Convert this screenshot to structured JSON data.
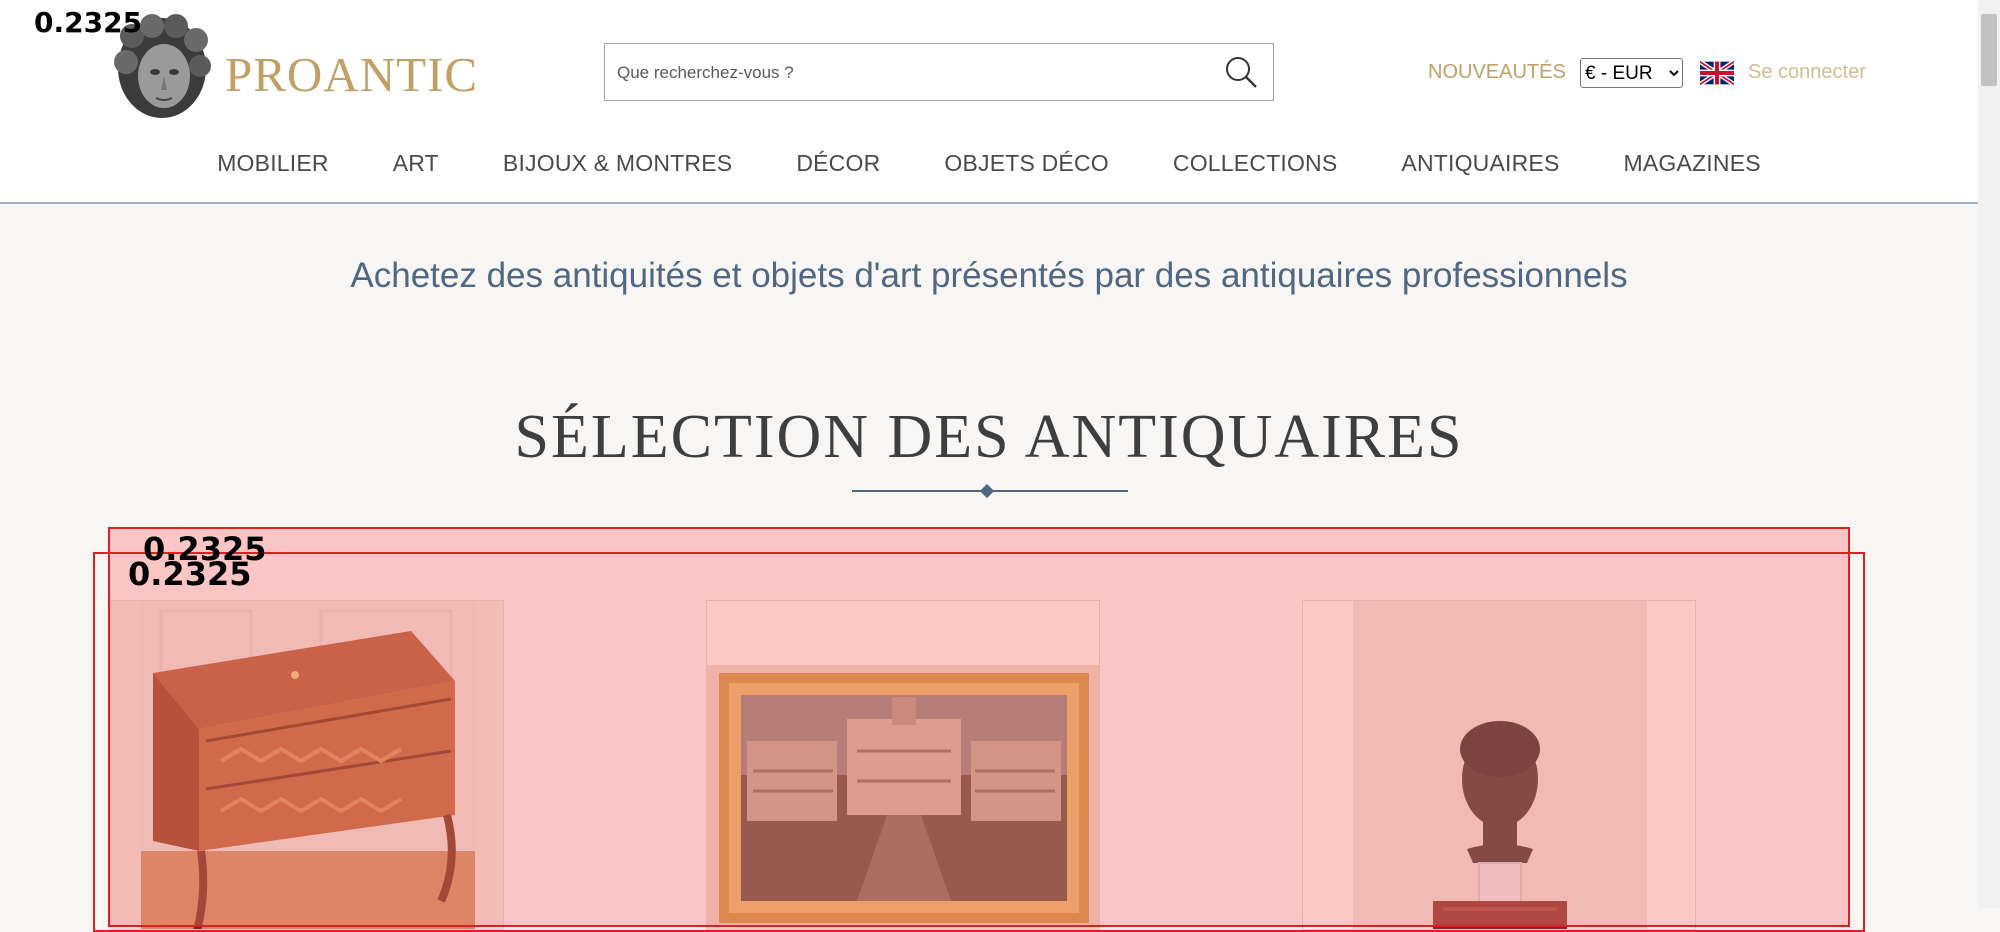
{
  "header": {
    "logo_text": "PROANTIC",
    "search_placeholder": "Que recherchez-vous ?",
    "nouveautes": "NOUVEAUTÉS",
    "currency_selected": "€ - EUR",
    "connect": "Se connecter"
  },
  "nav": {
    "items": [
      "MOBILIER",
      "ART",
      "BIJOUX & MONTRES",
      "DÉCOR",
      "OBJETS DÉCO",
      "COLLECTIONS",
      "ANTIQUAIRES",
      "MAGAZINES"
    ]
  },
  "main": {
    "tagline": "Achetez des antiquités et objets d'art présentés par des antiquaires professionnels",
    "section_title": "SÉLECTION DES ANTIQUAIRES"
  },
  "annotations": {
    "corner": "0.2325",
    "box1": "0.2325",
    "box2": "0.2325"
  },
  "colors": {
    "brand_gold": "#c0a064",
    "heading_blue": "#4f6781",
    "overlay_red": "#e02020"
  },
  "icons": [
    "search-icon",
    "uk-flag-icon",
    "logo-bust-icon"
  ]
}
